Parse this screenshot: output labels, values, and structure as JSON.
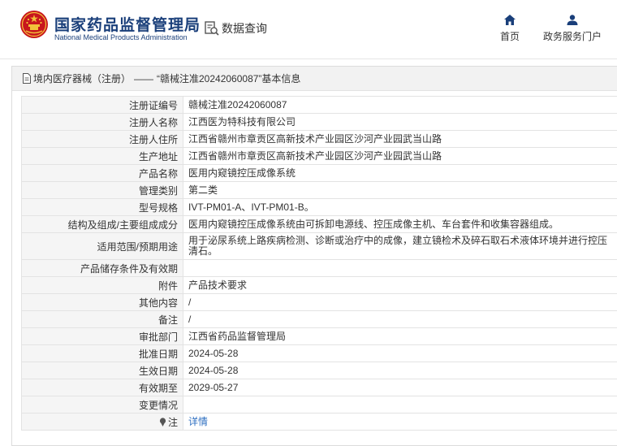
{
  "header": {
    "site_name_cn": "国家药品监督管理局",
    "site_name_en": "National Medical Products Administration",
    "data_query_label": "数据查询",
    "nav": [
      {
        "label": "首页",
        "icon": "home-icon"
      },
      {
        "label": "政务服务门户",
        "icon": "user-icon"
      }
    ]
  },
  "breadcrumb": {
    "category": "境内医疗器械（注册）",
    "separator": "——",
    "title": "“赣械注准20242060087”基本信息"
  },
  "table": {
    "rows": [
      {
        "label": "注册证编号",
        "value": "赣械注准20242060087"
      },
      {
        "label": "注册人名称",
        "value": "江西医为特科技有限公司"
      },
      {
        "label": "注册人住所",
        "value": "江西省赣州市章贡区高新技术产业园区沙河产业园武当山路"
      },
      {
        "label": "生产地址",
        "value": "江西省赣州市章贡区高新技术产业园区沙河产业园武当山路"
      },
      {
        "label": "产品名称",
        "value": "医用内窥镜控压成像系统"
      },
      {
        "label": "管理类别",
        "value": "第二类"
      },
      {
        "label": "型号规格",
        "value": "IVT-PM01-A、IVT-PM01-B。"
      },
      {
        "label": "结构及组成/主要组成成分",
        "value": "医用内窥镜控压成像系统由可拆卸电源线、控压成像主机、车台套件和收集容器组成。"
      },
      {
        "label": "适用范围/预期用途",
        "value": "用于泌尿系统上路疾病检测、诊断或治疗中的成像，建立镜检术及碎石取石术液体环境并进行控压清石。"
      },
      {
        "label": "产品储存条件及有效期",
        "value": ""
      },
      {
        "label": "附件",
        "value": "产品技术要求"
      },
      {
        "label": "其他内容",
        "value": "/"
      },
      {
        "label": "备注",
        "value": "/"
      },
      {
        "label": "审批部门",
        "value": "江西省药品监督管理局"
      },
      {
        "label": "批准日期",
        "value": "2024-05-28"
      },
      {
        "label": "生效日期",
        "value": "2024-05-28"
      },
      {
        "label": "有效期至",
        "value": "2029-05-27"
      },
      {
        "label": "变更情况",
        "value": ""
      }
    ],
    "note_label": "注",
    "note_link": "详情"
  },
  "colors": {
    "brand_blue": "#1a3f7a",
    "link_blue": "#2e6fc1",
    "label_bg": "#f5f5f5",
    "border": "#e3e3e3"
  }
}
